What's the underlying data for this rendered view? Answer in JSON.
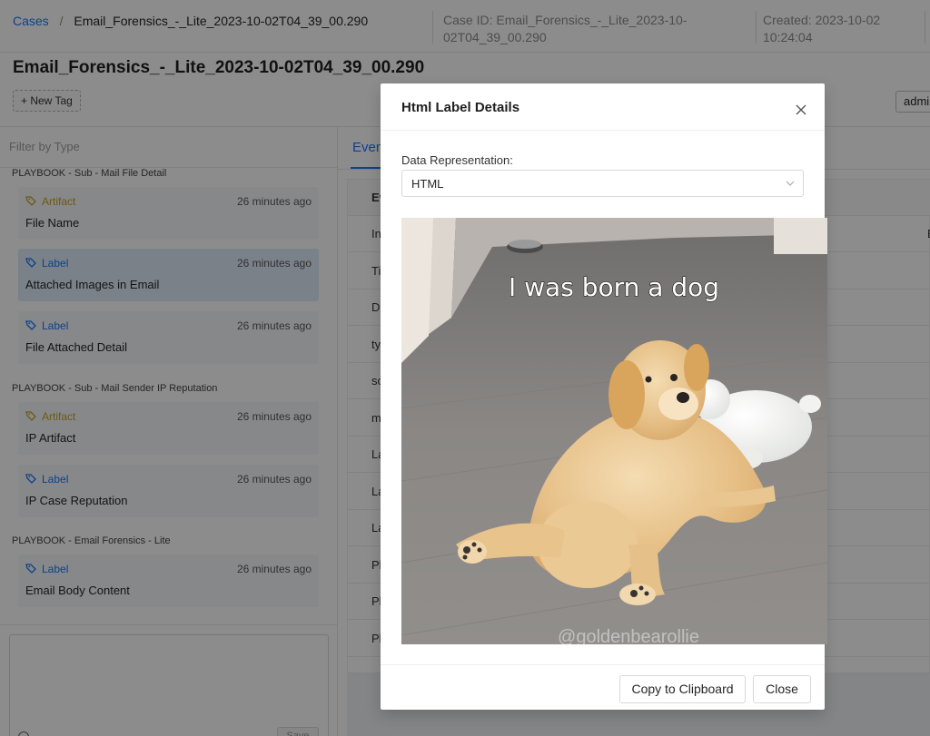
{
  "header": {
    "breadcrumb_root": "Cases",
    "breadcrumb_sep": "/",
    "breadcrumb_current": "Email_Forensics_-_Lite_2023-10-02T04_39_00.290",
    "case_id_line1": "Case ID: Email_Forensics_-_Lite_2023-10-",
    "case_id_line2": "02T04_39_00.290",
    "created_line1": "Created: 2023-10-02",
    "created_line2": "10:24:04",
    "case_title": "Email_Forensics_-_Lite_2023-10-02T04_39_00.290",
    "new_tag_label": "+ New Tag",
    "user_label": "admi"
  },
  "left_panel": {
    "filter_placeholder": "Filter by Type",
    "groups": [
      {
        "title": "PLAYBOOK - Sub - Mail File Detail",
        "items": [
          {
            "type": "Artifact",
            "time": "26 minutes ago",
            "name": "File Name"
          },
          {
            "type": "Label",
            "time": "26 minutes ago",
            "name": "Attached Images in Email"
          },
          {
            "type": "Label",
            "time": "26 minutes ago",
            "name": "File Attached Detail"
          }
        ]
      },
      {
        "title": "PLAYBOOK - Sub - Mail Sender IP Reputation",
        "items": [
          {
            "type": "Artifact",
            "time": "26 minutes ago",
            "name": "IP Artifact"
          },
          {
            "type": "Label",
            "time": "26 minutes ago",
            "name": "IP Case Reputation"
          }
        ]
      },
      {
        "title": "PLAYBOOK - Email Forensics - Lite",
        "items": [
          {
            "type": "Label",
            "time": "26 minutes ago",
            "name": "Email Body Content"
          }
        ]
      }
    ],
    "save_label": "Save"
  },
  "right_panel": {
    "tab_label": "Even",
    "rows": [
      "Ev",
      "In",
      "Ti",
      "D",
      "ty",
      "sc",
      "m",
      "La",
      "La",
      "La",
      "Pl",
      "Pl",
      "Pl"
    ],
    "row1_value": "E"
  },
  "modal": {
    "title": "Html Label Details",
    "field_label": "Data Representation:",
    "select_value": "HTML",
    "meme_caption": "I was born a dog",
    "watermark": "@goldenbearollie",
    "copy_button": "Copy to Clipboard",
    "close_button": "Close"
  },
  "colors": {
    "accent": "#1677ff",
    "artifact": "#c9a227",
    "selected_card": "#deebf9"
  }
}
